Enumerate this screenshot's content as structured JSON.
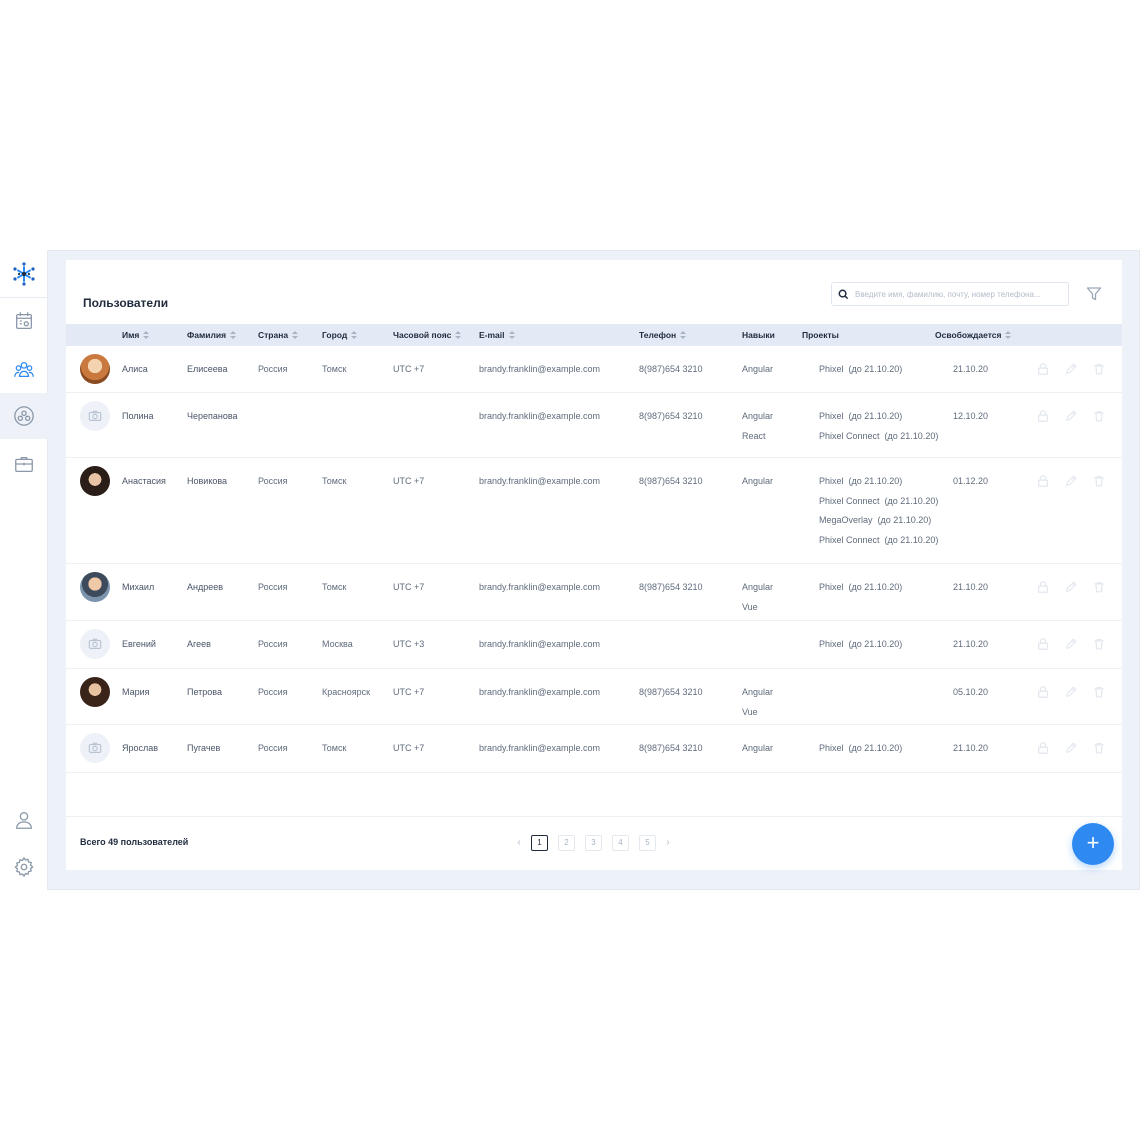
{
  "page": {
    "title": "Пользователи",
    "search_placeholder": "Введите имя, фамилию, почту, номер телефона...",
    "total_label": "Всего 49 пользователей",
    "add_label": "+"
  },
  "sidebar": {
    "logo": "snowflake-logo",
    "items": [
      {
        "icon": "calendar-icon"
      },
      {
        "icon": "users-icon",
        "current": true
      },
      {
        "icon": "team-circle-icon",
        "active": true
      },
      {
        "icon": "briefcase-icon"
      },
      {
        "icon": "profile-icon"
      },
      {
        "icon": "gear-icon"
      }
    ]
  },
  "table": {
    "columns": [
      "Имя",
      "Фамилия",
      "Страна",
      "Город",
      "Часовой пояс",
      "E-mail",
      "Телефон",
      "Навыки",
      "Проекты",
      "Освобождается"
    ],
    "rows": [
      {
        "first": "Алиса",
        "last": "Елисеева",
        "country": "Россия",
        "city": "Томск",
        "tz": "UTC +7",
        "email": "brandy.franklin@example.com",
        "phone": "8(987)654 3210",
        "skills": [
          "Angular"
        ],
        "projects": [
          "Phixel  (до 21.10.20)"
        ],
        "free": "21.10.20",
        "avatar": "photo"
      },
      {
        "first": "Полина",
        "last": "Черепанова",
        "country": "",
        "city": "",
        "tz": "",
        "email": "brandy.franklin@example.com",
        "phone": "8(987)654 3210",
        "skills": [
          "Angular",
          "React"
        ],
        "projects": [
          "Phixel  (до 21.10.20)",
          "Phixel Connect  (до 21.10.20)"
        ],
        "free": "12.10.20",
        "avatar": "placeholder"
      },
      {
        "first": "Анастасия",
        "last": "Новикова",
        "country": "Россия",
        "city": "Томск",
        "tz": "UTC +7",
        "email": "brandy.franklin@example.com",
        "phone": "8(987)654 3210",
        "skills": [
          "Angular"
        ],
        "projects": [
          "Phixel  (до 21.10.20)",
          "Phixel Connect  (до 21.10.20)",
          "MegaOverlay  (до 21.10.20)",
          "Phixel Connect  (до 21.10.20)"
        ],
        "free": "01.12.20",
        "avatar": "photo"
      },
      {
        "first": "Михаил",
        "last": "Андреев",
        "country": "Россия",
        "city": "Томск",
        "tz": "UTC +7",
        "email": "brandy.franklin@example.com",
        "phone": "8(987)654 3210",
        "skills": [
          "Angular",
          "Vue"
        ],
        "projects": [
          "Phixel  (до 21.10.20)"
        ],
        "free": "21.10.20",
        "avatar": "photo"
      },
      {
        "first": "Евгений",
        "last": "Агеев",
        "country": "Россия",
        "city": "Москва",
        "tz": "UTC +3",
        "email": "brandy.franklin@example.com",
        "phone": "",
        "skills": [],
        "projects": [
          "Phixel  (до 21.10.20)"
        ],
        "free": "21.10.20",
        "avatar": "placeholder"
      },
      {
        "first": "Мария",
        "last": "Петрова",
        "country": "Россия",
        "city": "Красноярск",
        "tz": "UTC +7",
        "email": "brandy.franklin@example.com",
        "phone": "8(987)654 3210",
        "skills": [
          "Angular",
          "Vue"
        ],
        "projects": [],
        "free": "05.10.20",
        "avatar": "photo"
      },
      {
        "first": "Ярослав",
        "last": "Пугачев",
        "country": "Россия",
        "city": "Томск",
        "tz": "UTC +7",
        "email": "brandy.franklin@example.com",
        "phone": "8(987)654 3210",
        "skills": [
          "Angular"
        ],
        "projects": [
          "Phixel  (до 21.10.20)"
        ],
        "free": "21.10.20",
        "avatar": "placeholder"
      }
    ]
  },
  "pagination": {
    "pages": [
      "1",
      "2",
      "3",
      "4",
      "5"
    ],
    "current": "1",
    "prev": "‹",
    "next": "›"
  },
  "colors": {
    "accent": "#2e8af0",
    "header_bg": "#e4eaf5",
    "page_bg": "#edf1f8"
  }
}
